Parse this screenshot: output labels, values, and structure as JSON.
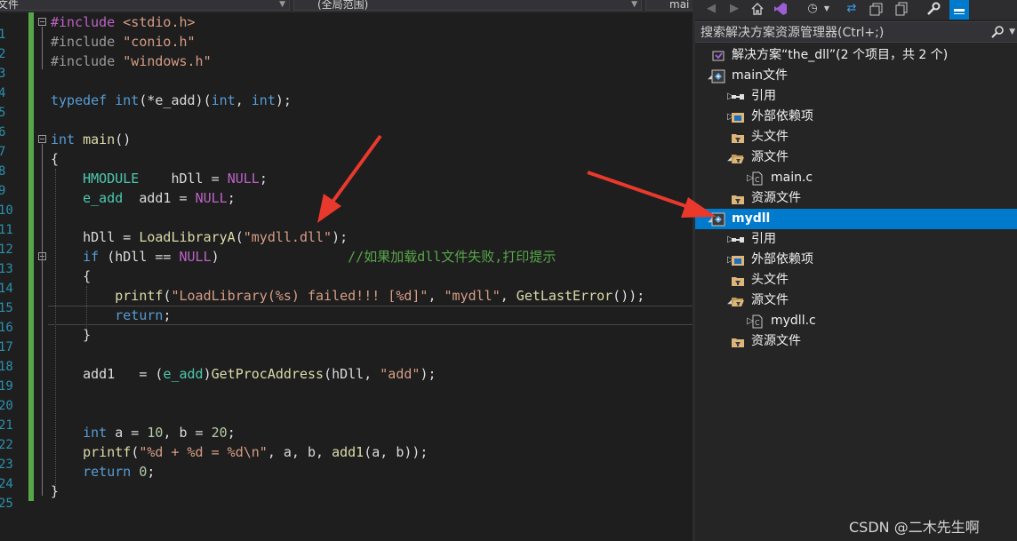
{
  "editor": {
    "nav": {
      "file_scope": "文件",
      "global_scope": "(全局范围)",
      "member_scope": "mai"
    },
    "lines": [
      {
        "n": "1",
        "tokens": [
          {
            "c": "mac",
            "t": "#include "
          },
          {
            "c": "str",
            "t": "<stdio.h>"
          }
        ]
      },
      {
        "n": "2",
        "tokens": [
          {
            "c": "inc",
            "t": "#include "
          },
          {
            "c": "str",
            "t": "\"conio.h\""
          }
        ]
      },
      {
        "n": "3",
        "tokens": [
          {
            "c": "inc",
            "t": "#include "
          },
          {
            "c": "str",
            "t": "\"windows.h\""
          }
        ]
      },
      {
        "n": "4",
        "tokens": []
      },
      {
        "n": "5",
        "tokens": [
          {
            "c": "kw",
            "t": "typedef "
          },
          {
            "c": "kw",
            "t": "int"
          },
          {
            "c": "",
            "t": "(*e_add)("
          },
          {
            "c": "kw",
            "t": "int"
          },
          {
            "c": "",
            "t": ", "
          },
          {
            "c": "kw",
            "t": "int"
          },
          {
            "c": "",
            "t": ");"
          }
        ]
      },
      {
        "n": "6",
        "tokens": []
      },
      {
        "n": "7",
        "tokens": [
          {
            "c": "kw",
            "t": "int "
          },
          {
            "c": "fn",
            "t": "main"
          },
          {
            "c": "",
            "t": "()"
          }
        ]
      },
      {
        "n": "8",
        "tokens": [
          {
            "c": "",
            "t": "{"
          }
        ]
      },
      {
        "n": "9",
        "tokens": [
          {
            "c": "",
            "t": "    "
          },
          {
            "c": "ty",
            "t": "HMODULE"
          },
          {
            "c": "",
            "t": "    hDll = "
          },
          {
            "c": "mac",
            "t": "NULL"
          },
          {
            "c": "",
            "t": ";"
          }
        ]
      },
      {
        "n": "10",
        "tokens": [
          {
            "c": "",
            "t": "    "
          },
          {
            "c": "ty",
            "t": "e_add"
          },
          {
            "c": "",
            "t": "  add1 = "
          },
          {
            "c": "mac",
            "t": "NULL"
          },
          {
            "c": "",
            "t": ";"
          }
        ]
      },
      {
        "n": "11",
        "tokens": []
      },
      {
        "n": "12",
        "tokens": [
          {
            "c": "",
            "t": "    hDll = "
          },
          {
            "c": "fn",
            "t": "LoadLibraryA"
          },
          {
            "c": "",
            "t": "("
          },
          {
            "c": "str",
            "t": "\"mydll.dll\""
          },
          {
            "c": "",
            "t": ");"
          }
        ]
      },
      {
        "n": "13",
        "tokens": [
          {
            "c": "",
            "t": "    "
          },
          {
            "c": "kw",
            "t": "if"
          },
          {
            "c": "",
            "t": " (hDll == "
          },
          {
            "c": "mac",
            "t": "NULL"
          },
          {
            "c": "",
            "t": ")                "
          },
          {
            "c": "cmt",
            "t": "//如果加载dll文件失败,打印提示"
          }
        ]
      },
      {
        "n": "14",
        "tokens": [
          {
            "c": "",
            "t": "    {"
          }
        ]
      },
      {
        "n": "15",
        "tokens": [
          {
            "c": "",
            "t": "        "
          },
          {
            "c": "fn",
            "t": "printf"
          },
          {
            "c": "",
            "t": "("
          },
          {
            "c": "str",
            "t": "\"LoadLibrary(%s) failed!!! [%d]\""
          },
          {
            "c": "",
            "t": ", "
          },
          {
            "c": "str",
            "t": "\"mydll\""
          },
          {
            "c": "",
            "t": ", "
          },
          {
            "c": "fn",
            "t": "GetLastError"
          },
          {
            "c": "",
            "t": "());"
          }
        ]
      },
      {
        "n": "16",
        "tokens": [
          {
            "c": "",
            "t": "        "
          },
          {
            "c": "kw",
            "t": "return"
          },
          {
            "c": "",
            "t": ";"
          }
        ]
      },
      {
        "n": "17",
        "tokens": [
          {
            "c": "",
            "t": "    }"
          }
        ]
      },
      {
        "n": "18",
        "tokens": []
      },
      {
        "n": "19",
        "tokens": [
          {
            "c": "",
            "t": "    add1   = ("
          },
          {
            "c": "ty",
            "t": "e_add"
          },
          {
            "c": "",
            "t": ")"
          },
          {
            "c": "fn",
            "t": "GetProcAddress"
          },
          {
            "c": "",
            "t": "(hDll, "
          },
          {
            "c": "str",
            "t": "\"add\""
          },
          {
            "c": "",
            "t": ");"
          }
        ]
      },
      {
        "n": "20",
        "tokens": []
      },
      {
        "n": "21",
        "tokens": []
      },
      {
        "n": "22",
        "tokens": [
          {
            "c": "",
            "t": "    "
          },
          {
            "c": "kw",
            "t": "int"
          },
          {
            "c": "",
            "t": " a = "
          },
          {
            "c": "num",
            "t": "10"
          },
          {
            "c": "",
            "t": ", b = "
          },
          {
            "c": "num",
            "t": "20"
          },
          {
            "c": "",
            "t": ";"
          }
        ]
      },
      {
        "n": "23",
        "tokens": [
          {
            "c": "",
            "t": "    "
          },
          {
            "c": "fn",
            "t": "printf"
          },
          {
            "c": "",
            "t": "("
          },
          {
            "c": "str",
            "t": "\"%d + %d = %d\\n\""
          },
          {
            "c": "",
            "t": ", a, b, "
          },
          {
            "c": "fn",
            "t": "add1"
          },
          {
            "c": "",
            "t": "(a, b));"
          }
        ]
      },
      {
        "n": "24",
        "tokens": [
          {
            "c": "",
            "t": "    "
          },
          {
            "c": "kw",
            "t": "return "
          },
          {
            "c": "num",
            "t": "0"
          },
          {
            "c": "",
            "t": ";"
          }
        ]
      },
      {
        "n": "25",
        "tokens": [
          {
            "c": "",
            "t": "}"
          }
        ]
      }
    ]
  },
  "explorer": {
    "search_placeholder": "搜索解决方案资源管理器(Ctrl+;)",
    "search_icon": "search-icon",
    "toolbar_icons": [
      "back-icon",
      "forward-icon",
      "home-icon",
      "vs-icon",
      "history-icon",
      "sync-icon",
      "collapse-icon",
      "copy-icon",
      "wrench-icon",
      "pin-icon"
    ],
    "tree": [
      {
        "label": "解决方案“the_dll”(2 个项目，共 2 个)",
        "icon": "solution-icon",
        "expander": "",
        "selected": false
      },
      {
        "label": "main文件",
        "icon": "project-icon",
        "expander": "expanded",
        "selected": false
      },
      {
        "label": "引用",
        "icon": "references-icon",
        "expander": "collapsed",
        "selected": false
      },
      {
        "label": "外部依赖项",
        "icon": "external-deps-icon",
        "expander": "collapsed",
        "selected": false
      },
      {
        "label": "头文件",
        "icon": "filter-folder-icon",
        "expander": "",
        "selected": false
      },
      {
        "label": "源文件",
        "icon": "filter-folder-open-icon",
        "expander": "expanded",
        "selected": false
      },
      {
        "label": "main.c",
        "icon": "c-file-icon",
        "expander": "collapsed",
        "selected": false
      },
      {
        "label": "资源文件",
        "icon": "filter-folder-icon",
        "expander": "",
        "selected": false
      },
      {
        "label": "mydll",
        "icon": "project-icon",
        "expander": "expanded",
        "selected": true
      },
      {
        "label": "引用",
        "icon": "references-icon",
        "expander": "collapsed",
        "selected": false
      },
      {
        "label": "外部依赖项",
        "icon": "external-deps-icon",
        "expander": "collapsed",
        "selected": false
      },
      {
        "label": "头文件",
        "icon": "filter-folder-icon",
        "expander": "",
        "selected": false
      },
      {
        "label": "源文件",
        "icon": "filter-folder-open-icon",
        "expander": "expanded",
        "selected": false
      },
      {
        "label": "mydll.c",
        "icon": "c-file-icon",
        "expander": "collapsed",
        "selected": false
      },
      {
        "label": "资源文件",
        "icon": "filter-folder-icon",
        "expander": "",
        "selected": false
      }
    ]
  },
  "watermark": "CSDN @二木先生啊",
  "colors": {
    "selection": "#007acc",
    "arrow": "#e8392c",
    "change_bar": "#57a64a"
  }
}
